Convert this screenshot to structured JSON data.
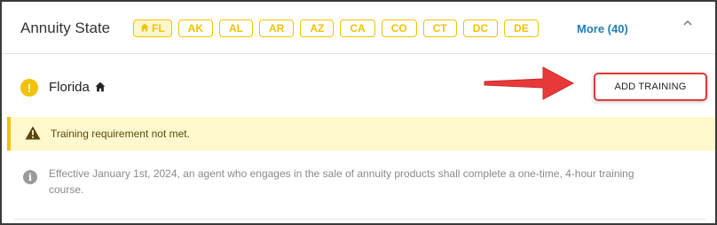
{
  "header": {
    "title": "Annuity State",
    "chips": [
      "FL",
      "AK",
      "AL",
      "AR",
      "AZ",
      "CA",
      "CO",
      "CT",
      "DC",
      "DE"
    ],
    "active_chip_icon": "home-icon",
    "more_label": "More (40)",
    "collapse_icon": "chevron-up-icon"
  },
  "state": {
    "name": "Florida",
    "status_icon": "alert-circle-icon",
    "status_symbol": "!",
    "home_icon": "home-icon",
    "add_button_label": "ADD TRAINING"
  },
  "warning": {
    "icon": "warning-triangle-icon",
    "text": "Training requirement not met."
  },
  "info": {
    "icon": "info-icon",
    "icon_symbol": "i",
    "text": "Effective January 1st, 2024, an agent who engages in the sale of annuity products shall complete a one-time, 4-hour training course."
  },
  "annotation": {
    "arrow_icon": "red-arrow-icon"
  },
  "colors": {
    "accent": "#f2c200",
    "link": "#1e7fb8",
    "warning_bg": "#fff8cc",
    "highlight": "#e03a3a"
  }
}
